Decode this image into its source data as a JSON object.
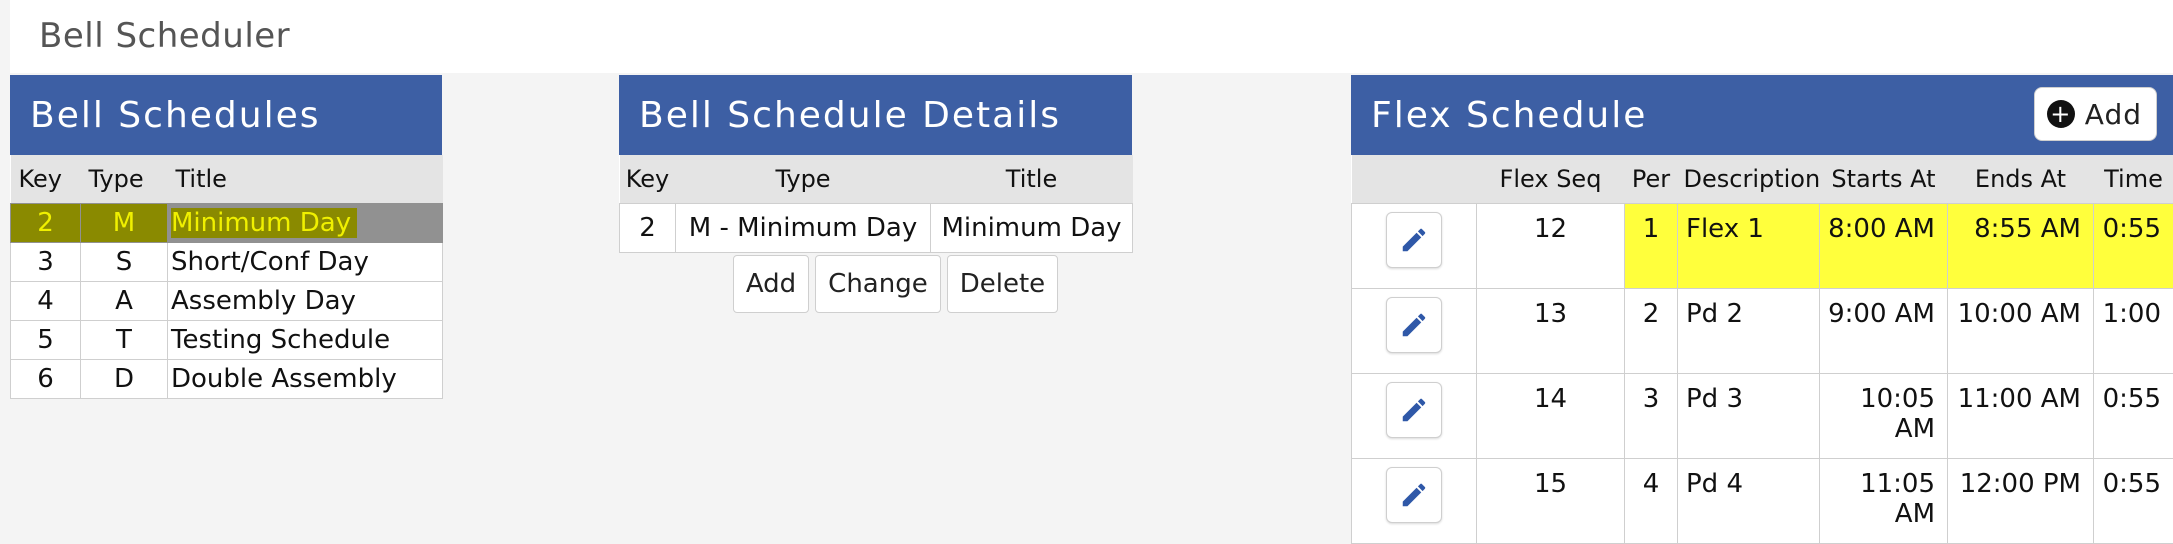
{
  "app": {
    "title": "Bell Scheduler"
  },
  "bell_schedules": {
    "title": "Bell Schedules",
    "columns": [
      "Key",
      "Type",
      "Title"
    ],
    "rows": [
      {
        "key": "2",
        "type": "M",
        "title": "Minimum Day"
      },
      {
        "key": "3",
        "type": "S",
        "title": "Short/Conf Day"
      },
      {
        "key": "4",
        "type": "A",
        "title": "Assembly Day"
      },
      {
        "key": "5",
        "type": "T",
        "title": "Testing Schedule"
      },
      {
        "key": "6",
        "type": "D",
        "title": "Double Assembly"
      }
    ]
  },
  "details": {
    "title": "Bell Schedule Details",
    "columns": [
      "Key",
      "Type",
      "Title"
    ],
    "row": {
      "key": "2",
      "type": "M - Minimum Day",
      "title": "Minimum Day"
    },
    "buttons": {
      "add": "Add",
      "change": "Change",
      "delete": "Delete"
    }
  },
  "flex": {
    "title": "Flex Schedule",
    "add_label": "Add",
    "columns": [
      "Flex Seq",
      "Per",
      "Description",
      "Starts At",
      "Ends At",
      "Time"
    ],
    "rows": [
      {
        "seq": "12",
        "per": "1",
        "desc": "Flex 1",
        "start": "8:00 AM",
        "end": "8:55 AM",
        "time": "0:55"
      },
      {
        "seq": "13",
        "per": "2",
        "desc": "Pd 2",
        "start": "9:00 AM",
        "end": "10:00 AM",
        "time": "1:00"
      },
      {
        "seq": "14",
        "per": "3",
        "desc": "Pd 3",
        "start": "10:05 AM",
        "end": "11:00 AM",
        "time": "0:55"
      },
      {
        "seq": "15",
        "per": "4",
        "desc": "Pd 4",
        "start": "11:05 AM",
        "end": "12:00 PM",
        "time": "0:55"
      }
    ]
  },
  "colors": {
    "header_blue": "#3d5fa4",
    "selection_gray": "#919191",
    "highlight_yellow": "#ffff3c"
  },
  "icons": {
    "edit": "pencil-icon",
    "add": "plus-circle-icon"
  }
}
